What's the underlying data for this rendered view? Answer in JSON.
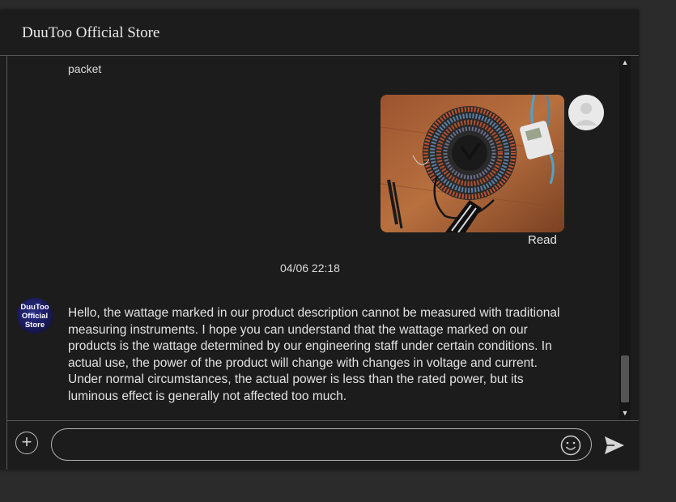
{
  "header": {
    "title": "DuuToo Official Store"
  },
  "conversation": {
    "previous_message_tail": "packet",
    "sent_image": {
      "status": "Read"
    },
    "timestamp": "04/06 22:18",
    "store_avatar_text": [
      "DuuToo",
      "Official",
      "Store"
    ],
    "store_reply": "Hello, the wattage marked in our product description cannot be measured with traditional measuring instruments. I hope you can understand that the wattage marked on our products is the wattage determined by our engineering staff under certain conditions. In actual use, the power of the product will change with changes in voltage and current. Under normal circumstances, the actual power is less than the rated power, but its luminous effect is generally not affected too much."
  },
  "composer": {
    "value": "",
    "icons": {
      "add": "plus-circle-icon",
      "emoji": "smiley-icon",
      "send": "send-arrow-icon"
    }
  },
  "colors": {
    "background": "#1c1c1c",
    "text": "#e2e2e2",
    "border": "#555555"
  }
}
